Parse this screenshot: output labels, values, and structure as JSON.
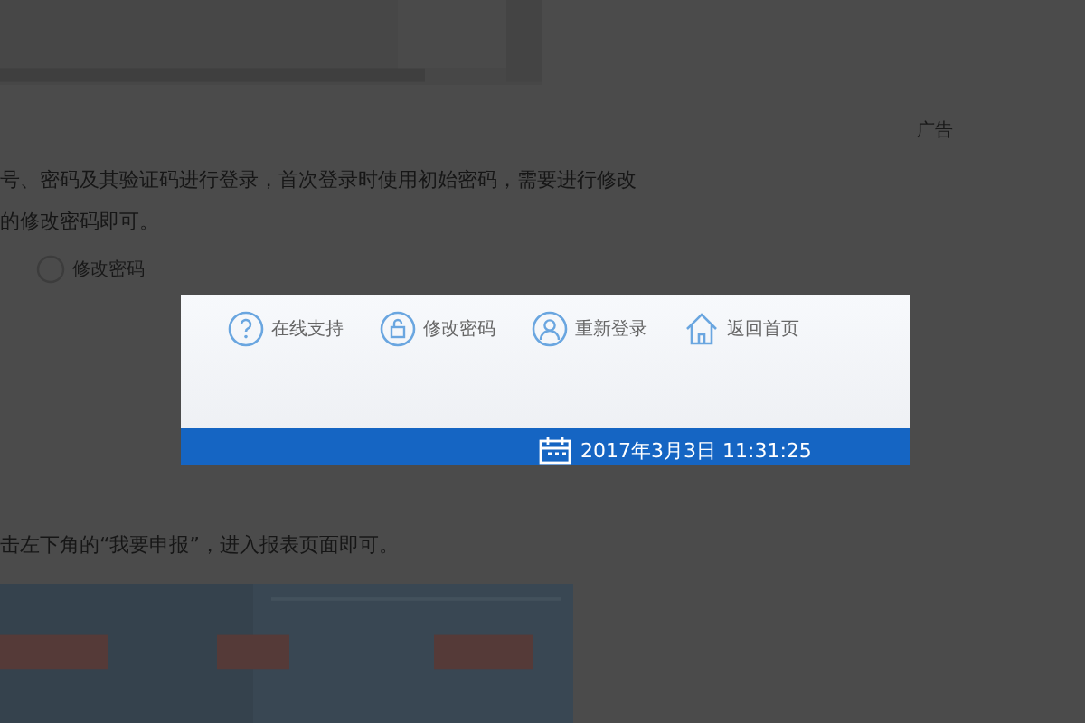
{
  "article": {
    "paragraph_1": [
      "号、密码及其验证码进行登录，首次登录时使用初始密码，需要进行修改",
      "的修改密码即可。"
    ],
    "dimmed_link": "修改密码",
    "paragraph_2": "击左下角的“我要申报”，进入报表页面即可。"
  },
  "sidebar": {
    "ad_label": "广告"
  },
  "highlight": {
    "links": [
      {
        "label": "在线支持"
      },
      {
        "label": "修改密码"
      },
      {
        "label": "重新登录"
      },
      {
        "label": "返回首页"
      }
    ],
    "datetime": "2017年3月3日 11:31:25"
  }
}
